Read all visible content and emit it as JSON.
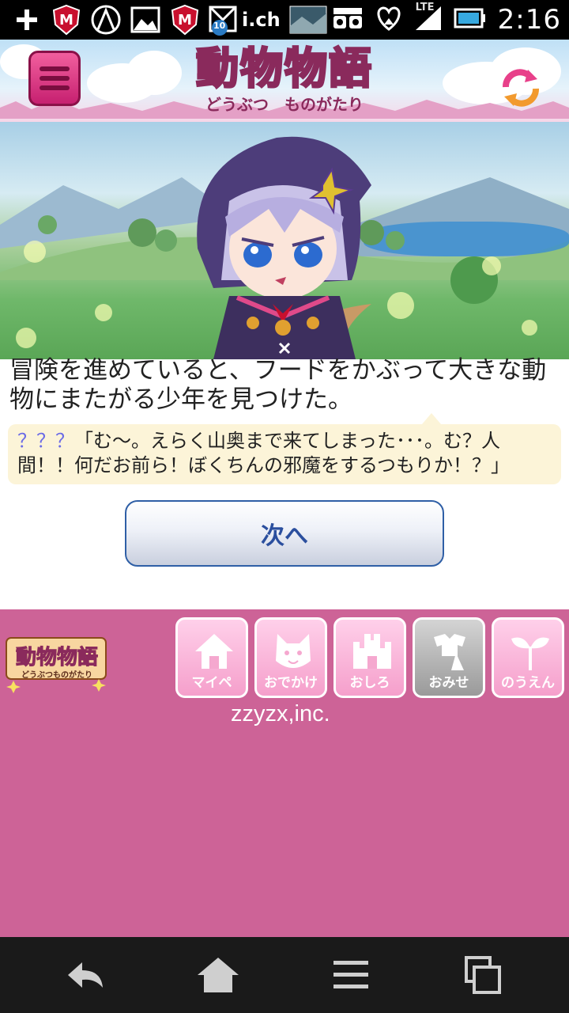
{
  "status_bar": {
    "time": "2:16",
    "network": "LTE",
    "notification_badge": "10",
    "notification_text": "i.ch",
    "icons": [
      "plus-icon",
      "mcafee-icon",
      "arrow-logo-icon",
      "picture-icon",
      "mcafee-icon",
      "mail-icon",
      "thumbnail-icon",
      "binoculars-icon",
      "heart-signal-icon",
      "battery-icon"
    ]
  },
  "header": {
    "logo_title": "動物物語",
    "logo_subtitle": "どうぶつ　ものがたり"
  },
  "story": {
    "narration": "冒険を進めていると、フードをかぶって大きな動物にまたがる少年を見つけた。",
    "speaker": "？？？",
    "dialogue": "「む～。えらく山奥まで来てしまった･･･。む？人間！！何だお前ら！ぼくちんの邪魔をするつもりか！？」"
  },
  "next_button": {
    "label": "次へ"
  },
  "footer": {
    "logo_title": "動物物語",
    "logo_subtitle": "どうぶつものがたり",
    "nav": [
      {
        "label": "マイペ",
        "icon": "house-icon"
      },
      {
        "label": "おでかけ",
        "icon": "cat-face-icon"
      },
      {
        "label": "おしろ",
        "icon": "castle-icon"
      },
      {
        "label": "おみせ",
        "icon": "shop-icon"
      },
      {
        "label": "のうえん",
        "icon": "sprout-icon"
      }
    ],
    "company": "zzyzx,inc."
  },
  "colors": {
    "footer_bg": "#cd6397",
    "bubble_bg": "#fcf4d8",
    "button_text": "#2b4f9e",
    "speaker": "#6b6be6"
  }
}
